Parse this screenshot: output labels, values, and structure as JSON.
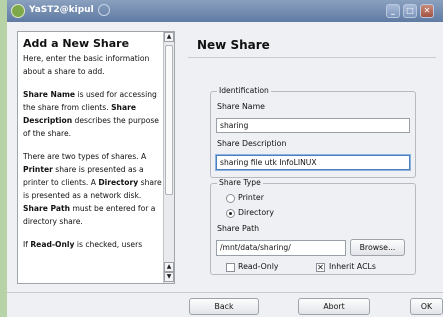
{
  "window": {
    "title": "YaST2@kipul"
  },
  "help": {
    "title": "Add a New Share",
    "intro": "Here, enter the basic information about a share to add.",
    "p1_a": "Share Name",
    "p1_b": " is used for accessing the share from clients. ",
    "p1_c": "Share Description",
    "p1_d": " describes the purpose of the share.",
    "p2_a": "There are two types of shares. A ",
    "p2_b": "Printer",
    "p2_c": " share is presented as a printer to clients. A ",
    "p2_d": "Directory",
    "p2_e": " share is presented as a network disk. ",
    "p2_f": "Share Path",
    "p2_g": " must be entered for a directory share.",
    "p3_a": "If ",
    "p3_b": "Read-Only",
    "p3_c": " is checked, users"
  },
  "main": {
    "title": "New Share",
    "identification": {
      "legend": "Identification",
      "name_label": "Share Name",
      "name_value": "sharing",
      "desc_label": "Share Description",
      "desc_value": "sharing file utk InfoLINUX"
    },
    "share_type": {
      "legend": "Share Type",
      "printer_label": "Printer",
      "directory_label": "Directory",
      "selected": "Directory",
      "path_label": "Share Path",
      "path_value": "/mnt/data/sharing/",
      "browse_label": "Browse...",
      "readonly_label": "Read-Only",
      "readonly_checked": false,
      "inherit_label": "Inherit ACLs",
      "inherit_checked": true
    }
  },
  "footer": {
    "back_label": "Back",
    "abort_label": "Abort",
    "ok_label": "OK"
  }
}
